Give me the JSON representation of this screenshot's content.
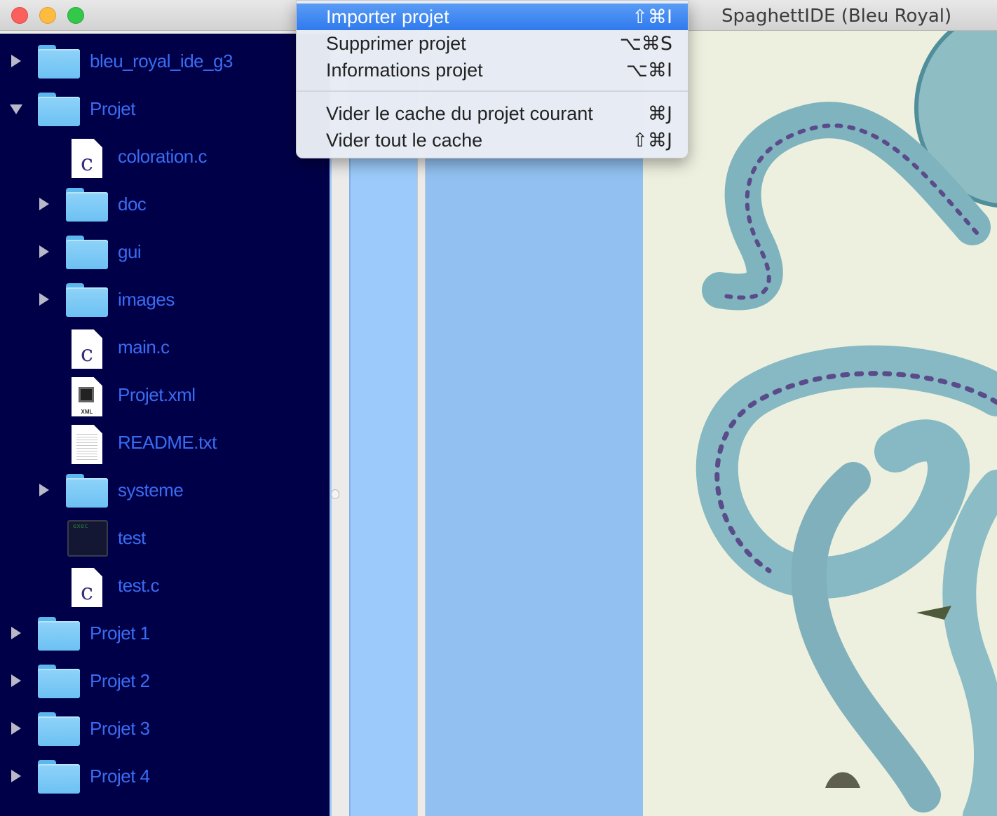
{
  "window": {
    "title": "SpaghettIDE (Bleu Royal)"
  },
  "menu": {
    "items": [
      {
        "label": "Importer projet",
        "shortcut": "⇧⌘I",
        "selected": true
      },
      {
        "label": "Supprimer projet",
        "shortcut": "⌥⌘S"
      },
      {
        "label": "Informations projet",
        "shortcut": "⌥⌘I"
      },
      {
        "label": "Vider le cache du projet courant",
        "shortcut": "⌘J"
      },
      {
        "label": "Vider tout le cache",
        "shortcut": "⇧⌘J"
      }
    ]
  },
  "sidebar": {
    "items": [
      {
        "label": "bleu_royal_ide_g3",
        "icon": "folder-icon",
        "expanded": false
      },
      {
        "label": "Projet",
        "icon": "folder-icon",
        "expanded": true
      },
      {
        "label": "coloration.c",
        "icon": "c-file-icon"
      },
      {
        "label": "doc",
        "icon": "folder-icon",
        "expanded": false
      },
      {
        "label": "gui",
        "icon": "folder-icon",
        "expanded": false
      },
      {
        "label": "images",
        "icon": "folder-icon",
        "expanded": false
      },
      {
        "label": "main.c",
        "icon": "c-file-icon"
      },
      {
        "label": "Projet.xml",
        "icon": "xml-file-icon",
        "icon_text": "XML"
      },
      {
        "label": "README.txt",
        "icon": "text-file-icon"
      },
      {
        "label": "systeme",
        "icon": "folder-icon",
        "expanded": false
      },
      {
        "label": "test",
        "icon": "executable-icon",
        "icon_text": "exec"
      },
      {
        "label": "test.c",
        "icon": "c-file-icon"
      },
      {
        "label": "Projet 1",
        "icon": "folder-icon",
        "expanded": false
      },
      {
        "label": "Projet 2",
        "icon": "folder-icon",
        "expanded": false
      },
      {
        "label": "Projet 3",
        "icon": "folder-icon",
        "expanded": false
      },
      {
        "label": "Projet 4",
        "icon": "folder-icon",
        "expanded": false
      }
    ]
  },
  "colors": {
    "sidebar_bg": "#000048",
    "sidebar_text": "#3a6cf2",
    "menu_highlight": "#3b82f0",
    "editor_col1": "#9ccbfb",
    "editor_col2": "#92c1f1"
  }
}
